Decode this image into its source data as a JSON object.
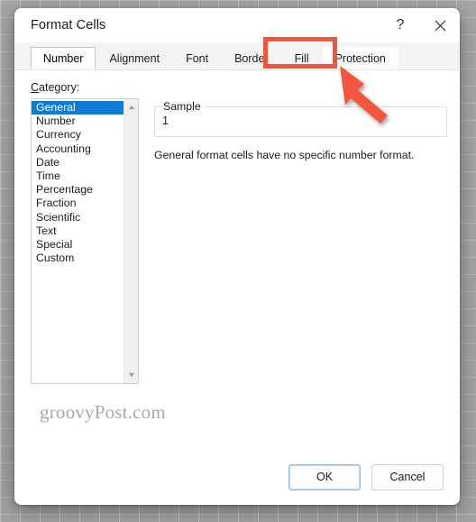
{
  "window": {
    "title": "Format Cells",
    "help_icon": "help-question-icon",
    "help_label": "?",
    "close_icon": "close-icon"
  },
  "tabs": [
    {
      "label": "Number",
      "selected": true,
      "highlighted": false
    },
    {
      "label": "Alignment",
      "selected": false,
      "highlighted": false
    },
    {
      "label": "Font",
      "selected": false,
      "highlighted": false
    },
    {
      "label": "Border",
      "selected": false,
      "highlighted": false
    },
    {
      "label": "Fill",
      "selected": false,
      "highlighted": false
    },
    {
      "label": "Protection",
      "selected": false,
      "highlighted": true
    }
  ],
  "category": {
    "label_accel": "C",
    "label_rest": "ategory:",
    "items": [
      "General",
      "Number",
      "Currency",
      "Accounting",
      "Date",
      "Time",
      "Percentage",
      "Fraction",
      "Scientific",
      "Text",
      "Special",
      "Custom"
    ],
    "selected": "General",
    "scroll_up_icon": "scroll-up-arrow-icon",
    "scroll_down_icon": "scroll-down-arrow-icon"
  },
  "sample": {
    "legend": "Sample",
    "value": "1"
  },
  "description": "General format cells have no specific number format.",
  "footer": {
    "ok_label": "OK",
    "cancel_label": "Cancel"
  },
  "watermark": "groovyPost.com",
  "annotation": {
    "color": "#f4543c",
    "target": "Protection",
    "arrow_icon": "pointer-arrow-icon"
  },
  "colors": {
    "selection_blue": "#0f7bd4",
    "annotation_red": "#f4543c",
    "dialog_bg": "#ffffff",
    "tabstrip_bg": "#f3f3f3",
    "backdrop_grey": "#a4a4a4"
  }
}
